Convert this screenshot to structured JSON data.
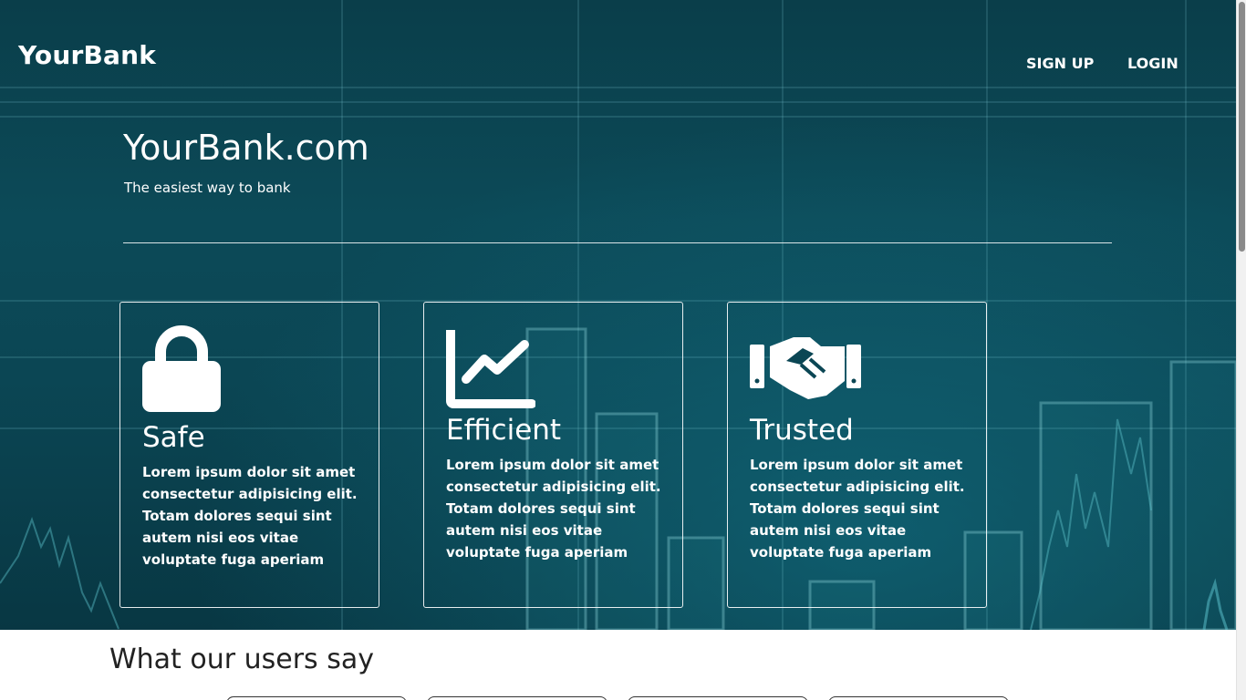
{
  "header": {
    "brand": "YourBank",
    "nav": [
      {
        "label": "SIGN UP"
      },
      {
        "label": "LOGIN"
      }
    ]
  },
  "hero": {
    "title": "YourBank.com",
    "subtitle": "The easiest way to bank"
  },
  "features": [
    {
      "icon": "lock-icon",
      "title": "Safe",
      "text": "Lorem ipsum dolor sit amet consectetur adipisicing elit. Totam dolores sequi sint autem nisi eos vitae voluptate fuga aperiam"
    },
    {
      "icon": "line-chart-icon",
      "title": "Efficient",
      "text": "Lorem ipsum dolor sit amet consectetur adipisicing elit. Totam dolores sequi sint autem nisi eos vitae voluptate fuga aperiam"
    },
    {
      "icon": "handshake-icon",
      "title": "Trusted",
      "text": "Lorem ipsum dolor sit amet consectetur adipisicing elit. Totam dolores sequi sint autem nisi eos vitae voluptate fuga aperiam"
    }
  ],
  "testimonials": {
    "title": "What our users say"
  },
  "colors": {
    "hero_bg": "#0b4654",
    "text_light": "#ffffff",
    "text_dark": "#222222"
  }
}
